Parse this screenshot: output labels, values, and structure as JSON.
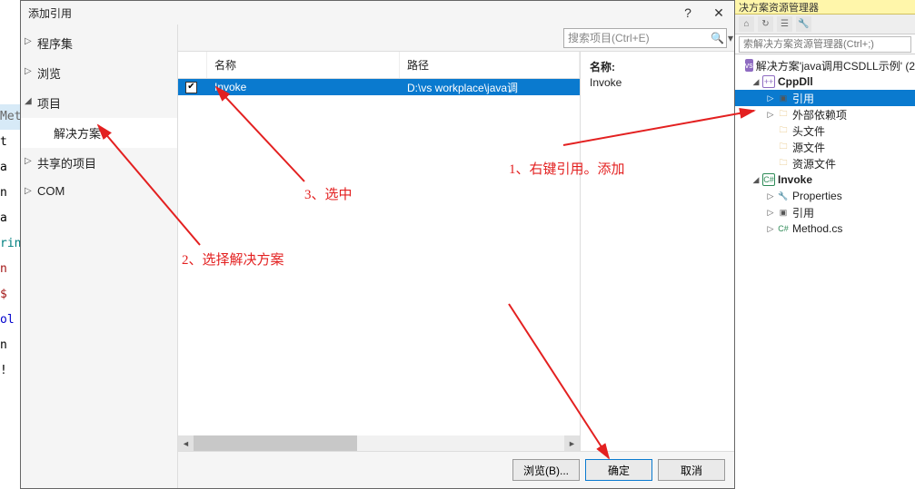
{
  "dialog": {
    "title": "添加引用",
    "help_icon": "?",
    "close_icon": "✕",
    "sidebar": {
      "items": [
        {
          "label": "程序集",
          "caret": "▷",
          "sub": false
        },
        {
          "label": "浏览",
          "caret": "▷",
          "sub": false
        },
        {
          "label": "项目",
          "caret": "◢",
          "sub": false
        },
        {
          "label": "解决方案",
          "caret": "",
          "sub": true,
          "selected": true
        },
        {
          "label": "共享的项目",
          "caret": "▷",
          "sub": false
        },
        {
          "label": "COM",
          "caret": "▷",
          "sub": false
        }
      ]
    },
    "search": {
      "placeholder": "搜索项目(Ctrl+E)"
    },
    "columns": {
      "name": "名称",
      "path": "路径"
    },
    "rows": [
      {
        "checked": true,
        "name": "Invoke",
        "path": "D:\\vs workplace\\java调"
      }
    ],
    "detail": {
      "label": "名称:",
      "value": "Invoke"
    },
    "buttons": {
      "browse": "浏览(B)...",
      "ok": "确定",
      "cancel": "取消"
    }
  },
  "explorer": {
    "title": "决方案资源管理器",
    "search_placeholder": "索解决方案资源管理器(Ctrl+;)",
    "tree": {
      "solution": "解决方案'java调用CSDLL示例' (2",
      "cppdll": "CppDll",
      "ref": "引用",
      "extdep": "外部依赖项",
      "headers": "头文件",
      "sources": "源文件",
      "resources": "资源文件",
      "invoke": "Invoke",
      "properties": "Properties",
      "ref2": "引用",
      "method": "Method.cs"
    }
  },
  "annotations": {
    "a1": "1、右键引用。添加",
    "a2": "2、选择解决方案",
    "a3": "3、选中"
  },
  "bgcode": {
    "met": "Met",
    "t": "t a",
    "n": "n a",
    "rin": "rin",
    "d": "n $",
    "ol": "ol",
    "ex": "n !"
  }
}
